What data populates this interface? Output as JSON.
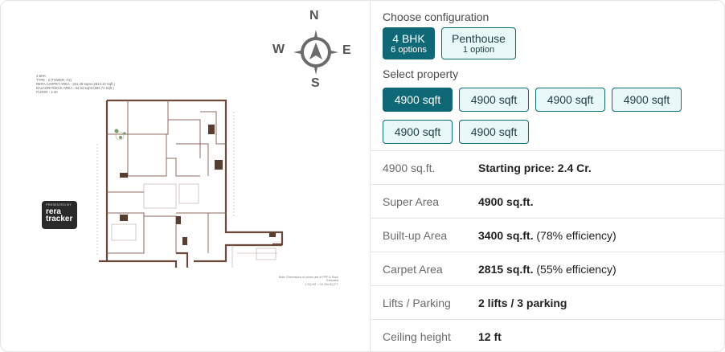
{
  "compass": {
    "north": "N",
    "south": "S",
    "east": "E",
    "west": "W"
  },
  "floorplan": {
    "notes": [
      "4 BHK",
      "TYPE - 3 (TOWER -T3)",
      "RERA CARPET AREA - 261.49 Sqmt (2814.10 Sqft.)",
      "BALCONY/DECK AREA - 64.54 Sqmt (694.72 Sqft.)",
      "FLOOR - 1-40"
    ],
    "footnote": [
      "Note: Dimensions of rooms are of PPP & Rock Excluded",
      "1 SQ.MT = 10.764 SQ.FT."
    ]
  },
  "badge": {
    "top": "PRESENTED BY",
    "brand_line1": "rera",
    "brand_line2": "tracker"
  },
  "configuration": {
    "title": "Choose configuration",
    "options": [
      {
        "name": "4 BHK",
        "count": "6 options",
        "active": true
      },
      {
        "name": "Penthouse",
        "count": "1 option",
        "active": false
      }
    ]
  },
  "property": {
    "title": "Select property",
    "options": [
      "4900 sqft",
      "4900 sqft",
      "4900 sqft",
      "4900 sqft",
      "4900 sqft",
      "4900 sqft"
    ]
  },
  "details": [
    {
      "label": "4900 sq.ft.",
      "value_bold": "Starting price: 2.4 Cr.",
      "value_rest": ""
    },
    {
      "label": "Super Area",
      "value_bold": "4900 sq.ft.",
      "value_rest": ""
    },
    {
      "label": "Built-up Area",
      "value_bold": "3400 sq.ft.",
      "value_rest": " (78% efficiency)"
    },
    {
      "label": "Carpet Area",
      "value_bold": "2815 sq.ft.",
      "value_rest": " (55% efficiency)"
    },
    {
      "label": "Lifts / Parking",
      "value_bold": "2 lifts / 3 parking",
      "value_rest": ""
    },
    {
      "label": "Ceiling height",
      "value_bold": "12 ft",
      "value_rest": ""
    }
  ],
  "colors": {
    "accent": "#0f6876",
    "chip_bg": "#e8f7f8",
    "border": "#e3e3e3"
  }
}
